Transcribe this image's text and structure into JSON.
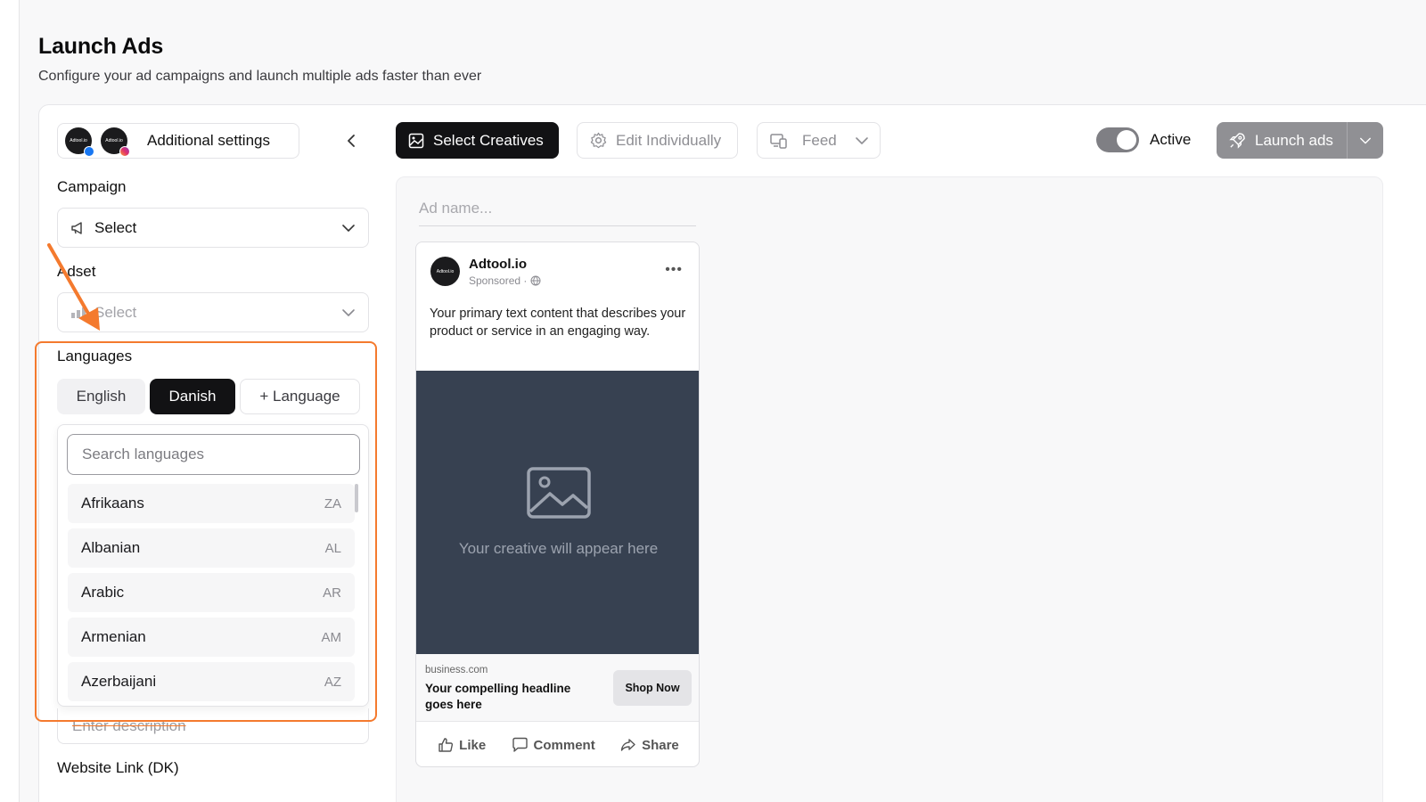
{
  "page": {
    "title": "Launch Ads",
    "subtitle": "Configure your ad campaigns and launch multiple ads faster than ever"
  },
  "account": {
    "label": "Additional settings",
    "avatar_text": "Adtool.io",
    "badges": [
      "facebook",
      "instagram"
    ]
  },
  "campaign": {
    "label": "Campaign",
    "value": "Select",
    "icon": "megaphone-icon"
  },
  "adset": {
    "label": "Adset",
    "value": "Select"
  },
  "languages": {
    "label": "Languages",
    "tabs": [
      {
        "label": "English",
        "selected": false
      },
      {
        "label": "Danish",
        "selected": true
      }
    ],
    "add_label": "+ Language",
    "search_placeholder": "Search languages",
    "items": [
      {
        "name": "Afrikaans",
        "code": "ZA"
      },
      {
        "name": "Albanian",
        "code": "AL"
      },
      {
        "name": "Arabic",
        "code": "AR"
      },
      {
        "name": "Armenian",
        "code": "AM"
      },
      {
        "name": "Azerbaijani",
        "code": "AZ"
      }
    ]
  },
  "description": {
    "placeholder": "Enter description"
  },
  "website_link": {
    "label": "Website Link (DK)"
  },
  "toolbar": {
    "select_creatives": "Select Creatives",
    "edit_individually": "Edit Individually",
    "feed": "Feed",
    "active_label": "Active",
    "active_on": true,
    "launch": "Launch ads"
  },
  "preview": {
    "ad_name_placeholder": "Ad name...",
    "page_name": "Adtool.io",
    "sponsored": "Sponsored ·",
    "primary_text": "Your primary text content that describes your product or service in an engaging way.",
    "media_placeholder": "Your creative will appear here",
    "domain": "business.com",
    "headline": "Your compelling headline goes here",
    "cta": "Shop Now",
    "actions": {
      "like": "Like",
      "comment": "Comment",
      "share": "Share"
    }
  },
  "colors": {
    "accent_dark": "#121214",
    "highlight": "#f47a2e",
    "media_bg": "#374151",
    "launch_bg": "#909094"
  }
}
